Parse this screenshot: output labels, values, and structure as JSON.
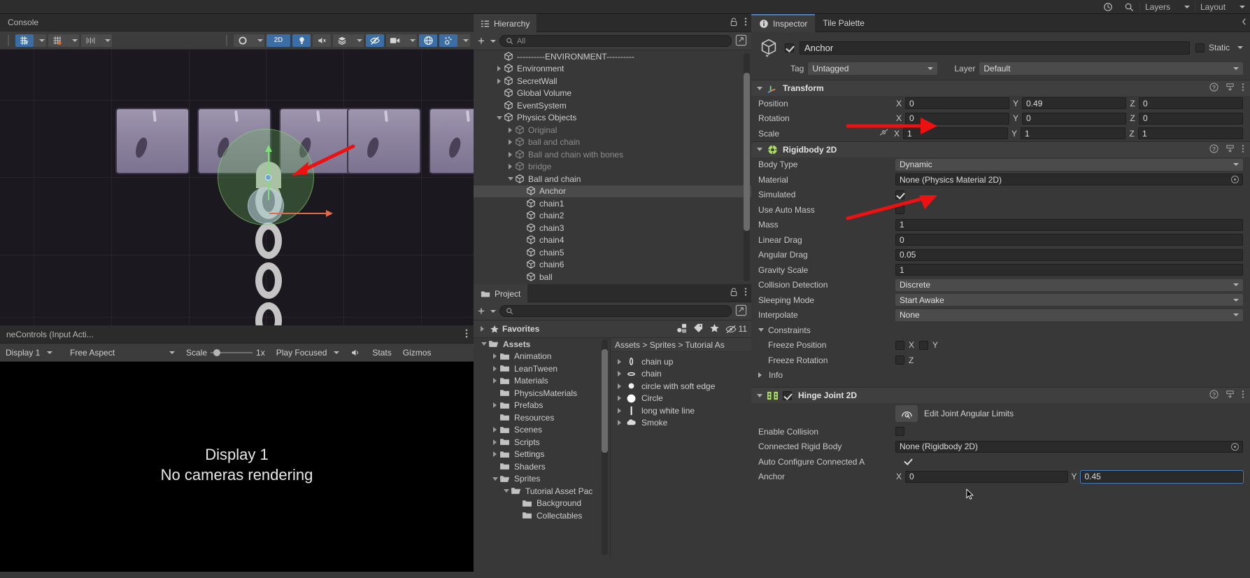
{
  "topbar": {
    "buttons": [
      {
        "name": "history-icon",
        "label": ""
      },
      {
        "name": "search-icon",
        "label": ""
      },
      {
        "name": "layers-dropdown",
        "label": "Layers"
      },
      {
        "name": "layout-dropdown",
        "label": "Layout"
      }
    ],
    "layers_label": "Layers",
    "layout_label": "Layout"
  },
  "scene_panel": {
    "console_tab": "Console",
    "toolbar": {
      "grid_axis": "Y",
      "mode_2d": "2D",
      "items": [
        "grid-axis-tool",
        "grid-snap-tool",
        "snap-increment-tool",
        "shading-mode",
        "2D",
        "lighting-toggle",
        "audio-toggle",
        "fx-toggle",
        "camera-toggle",
        "gizmos-toggle"
      ]
    }
  },
  "game_panel": {
    "tab_label": "neControls (Input Acti...",
    "toolbar": {
      "display": "Display 1",
      "aspect": "Free Aspect",
      "scale_label": "Scale",
      "scale_value": "1x",
      "play_focused": "Play Focused",
      "stats": "Stats",
      "gizmos": "Gizmos"
    },
    "message_line1": "Display 1",
    "message_line2": "No cameras rendering"
  },
  "hierarchy": {
    "tab_label": "Hierarchy",
    "search_placeholder": "All",
    "items": [
      {
        "label": "----------ENVIRONMENT----------",
        "depth": 1,
        "arrow": "none",
        "dim": false,
        "selected": false
      },
      {
        "label": "Environment",
        "depth": 1,
        "arrow": "closed",
        "dim": false,
        "selected": false
      },
      {
        "label": "SecretWall",
        "depth": 1,
        "arrow": "closed",
        "dim": false,
        "selected": false
      },
      {
        "label": "Global Volume",
        "depth": 1,
        "arrow": "none",
        "dim": false,
        "selected": false
      },
      {
        "label": "EventSystem",
        "depth": 1,
        "arrow": "none",
        "dim": false,
        "selected": false
      },
      {
        "label": "Physics Objects",
        "depth": 1,
        "arrow": "open",
        "dim": false,
        "selected": false
      },
      {
        "label": "Original",
        "depth": 2,
        "arrow": "closed",
        "dim": true,
        "selected": false
      },
      {
        "label": "ball and chain",
        "depth": 2,
        "arrow": "closed",
        "dim": true,
        "selected": false
      },
      {
        "label": "Ball and chain with bones",
        "depth": 2,
        "arrow": "closed",
        "dim": true,
        "selected": false
      },
      {
        "label": "bridge",
        "depth": 2,
        "arrow": "closed",
        "dim": true,
        "selected": false
      },
      {
        "label": "Ball and chain",
        "depth": 2,
        "arrow": "open",
        "dim": false,
        "selected": false
      },
      {
        "label": "Anchor",
        "depth": 3,
        "arrow": "none",
        "dim": false,
        "selected": true
      },
      {
        "label": "chain1",
        "depth": 3,
        "arrow": "none",
        "dim": false,
        "selected": false
      },
      {
        "label": "chain2",
        "depth": 3,
        "arrow": "none",
        "dim": false,
        "selected": false
      },
      {
        "label": "chain3",
        "depth": 3,
        "arrow": "none",
        "dim": false,
        "selected": false
      },
      {
        "label": "chain4",
        "depth": 3,
        "arrow": "none",
        "dim": false,
        "selected": false
      },
      {
        "label": "chain5",
        "depth": 3,
        "arrow": "none",
        "dim": false,
        "selected": false
      },
      {
        "label": "chain6",
        "depth": 3,
        "arrow": "none",
        "dim": false,
        "selected": false
      },
      {
        "label": "ball",
        "depth": 3,
        "arrow": "none",
        "dim": false,
        "selected": false
      }
    ]
  },
  "project": {
    "tab_label": "Project",
    "search_placeholder": "",
    "badge_count": "11",
    "favorites_label": "Favorites",
    "breadcrumb": "Assets > Sprites > Tutorial As",
    "folders": [
      {
        "label": "Assets",
        "depth": 0,
        "arrow": "open",
        "open": true
      },
      {
        "label": "Animation",
        "depth": 1,
        "arrow": "closed",
        "open": false
      },
      {
        "label": "LeanTween",
        "depth": 1,
        "arrow": "closed",
        "open": false
      },
      {
        "label": "Materials",
        "depth": 1,
        "arrow": "closed",
        "open": false
      },
      {
        "label": "PhysicsMaterials",
        "depth": 1,
        "arrow": "none",
        "open": false
      },
      {
        "label": "Prefabs",
        "depth": 1,
        "arrow": "closed",
        "open": false
      },
      {
        "label": "Resources",
        "depth": 1,
        "arrow": "none",
        "open": false
      },
      {
        "label": "Scenes",
        "depth": 1,
        "arrow": "closed",
        "open": false
      },
      {
        "label": "Scripts",
        "depth": 1,
        "arrow": "closed",
        "open": false
      },
      {
        "label": "Settings",
        "depth": 1,
        "arrow": "closed",
        "open": false
      },
      {
        "label": "Shaders",
        "depth": 1,
        "arrow": "none",
        "open": false
      },
      {
        "label": "Sprites",
        "depth": 1,
        "arrow": "open",
        "open": true
      },
      {
        "label": "Tutorial Asset Pac",
        "depth": 2,
        "arrow": "open",
        "open": true
      },
      {
        "label": "Background",
        "depth": 3,
        "arrow": "none",
        "open": false
      },
      {
        "label": "Collectables",
        "depth": 3,
        "arrow": "none",
        "open": false
      }
    ],
    "assets": [
      {
        "label": "chain up",
        "icon": "chain-up-sprite"
      },
      {
        "label": "chain",
        "icon": "chain-sprite"
      },
      {
        "label": "circle with soft edge",
        "icon": "circle-soft-sprite"
      },
      {
        "label": "Circle",
        "icon": "circle-sprite"
      },
      {
        "label": "long white line",
        "icon": "line-sprite"
      },
      {
        "label": "Smoke",
        "icon": "smoke-sprite"
      }
    ]
  },
  "inspector": {
    "tabs": [
      {
        "label": "Inspector",
        "active": true
      },
      {
        "label": "Tile Palette",
        "active": false
      }
    ],
    "object": {
      "name": "Anchor",
      "enabled": true,
      "static_label": "Static",
      "tag_label": "Tag",
      "tag_value": "Untagged",
      "layer_label": "Layer",
      "layer_value": "Default"
    },
    "transform": {
      "title": "Transform",
      "rows": [
        {
          "label": "Position",
          "x": "0",
          "y": "0.49",
          "z": "0"
        },
        {
          "label": "Rotation",
          "x": "0",
          "y": "0",
          "z": "0"
        },
        {
          "label": "Scale",
          "x": "1",
          "y": "1",
          "z": "1"
        }
      ]
    },
    "rigidbody2d": {
      "title": "Rigidbody 2D",
      "body_type_label": "Body Type",
      "body_type_value": "Dynamic",
      "material_label": "Material",
      "material_value": "None (Physics Material 2D)",
      "simulated_label": "Simulated",
      "simulated_checked": true,
      "use_auto_mass_label": "Use Auto Mass",
      "use_auto_mass_checked": false,
      "mass_label": "Mass",
      "mass_value": "1",
      "linear_drag_label": "Linear Drag",
      "linear_drag_value": "0",
      "angular_drag_label": "Angular Drag",
      "angular_drag_value": "0.05",
      "gravity_scale_label": "Gravity Scale",
      "gravity_scale_value": "1",
      "collision_detection_label": "Collision Detection",
      "collision_detection_value": "Discrete",
      "sleeping_mode_label": "Sleeping Mode",
      "sleeping_mode_value": "Start Awake",
      "interpolate_label": "Interpolate",
      "interpolate_value": "None",
      "constraints_label": "Constraints",
      "freeze_position_label": "Freeze Position",
      "freeze_position_x": "X",
      "freeze_position_y": "Y",
      "freeze_rotation_label": "Freeze Rotation",
      "freeze_rotation_z": "Z",
      "info_label": "Info"
    },
    "hinge_joint2d": {
      "title": "Hinge Joint 2D",
      "enabled": true,
      "edit_joint_label": "Edit Joint Angular Limits",
      "enable_collision_label": "Enable Collision",
      "enable_collision_checked": false,
      "connected_rigid_body_label": "Connected Rigid Body",
      "connected_rigid_body_value": "None (Rigidbody 2D)",
      "auto_configure_label": "Auto Configure Connected A",
      "auto_configure_checked": true,
      "anchor_label": "Anchor",
      "anchor_x": "0",
      "anchor_y": "0.45"
    }
  },
  "colors": {
    "accent_blue": "#4a80c0",
    "annotation_red": "#ee1111",
    "rigidbody_icon_green": "#a8e05a",
    "selection_gray": "#4a4a4a"
  }
}
